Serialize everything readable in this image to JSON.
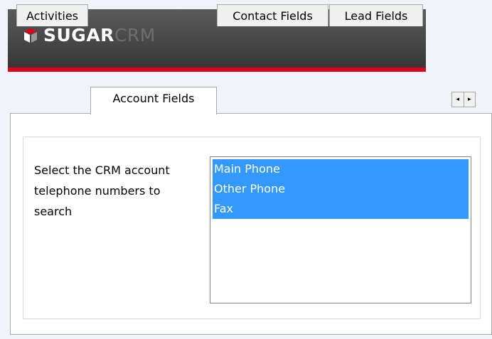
{
  "branding": {
    "logo_sugar": "SUGAR",
    "logo_crm": "CRM",
    "brand_red": "#e0001b"
  },
  "tabs": [
    {
      "label": "Activities",
      "active": false
    },
    {
      "label": "Account Fields",
      "active": true
    },
    {
      "label": "Contact Fields",
      "active": false
    },
    {
      "label": "Lead Fields",
      "active": false
    }
  ],
  "tab_scroll": {
    "left": "◂",
    "right": "▸"
  },
  "account_fields": {
    "instruction": "Select the CRM account telephone numbers to search",
    "phone_options": [
      {
        "label": "Main Phone",
        "selected": true
      },
      {
        "label": "Other Phone",
        "selected": true
      },
      {
        "label": "Fax",
        "selected": true
      }
    ],
    "selection_color": "#3399ff"
  }
}
